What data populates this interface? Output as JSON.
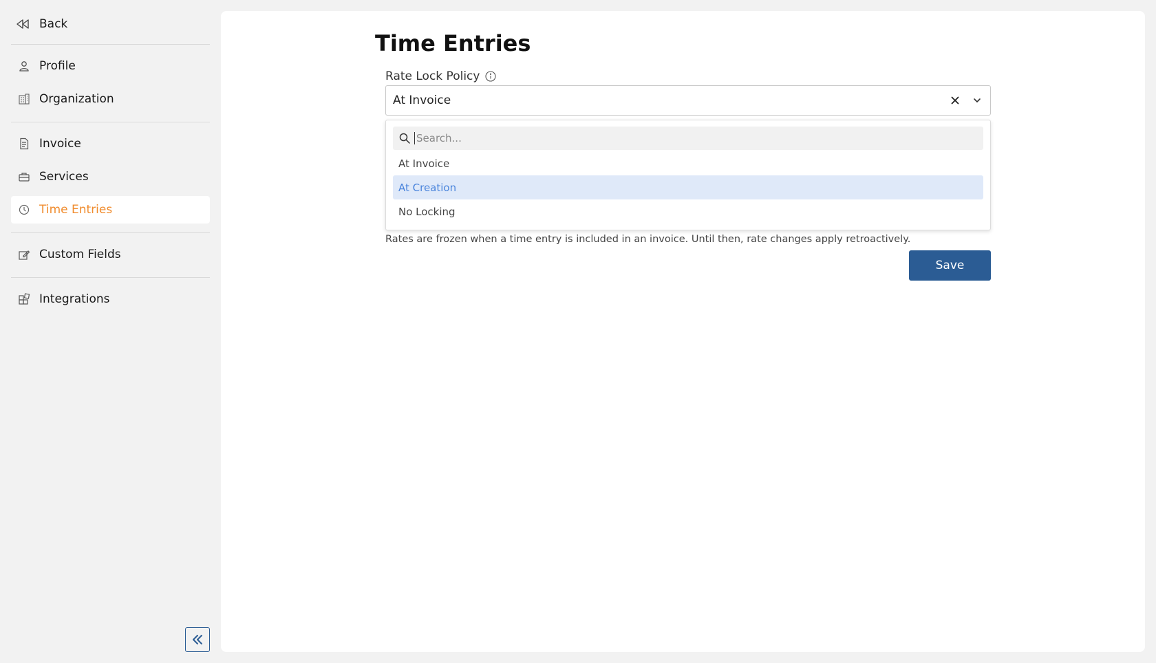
{
  "sidebar": {
    "back_label": "Back",
    "groups": [
      [
        {
          "label": "Profile",
          "icon": "user-icon"
        },
        {
          "label": "Organization",
          "icon": "building-icon"
        }
      ],
      [
        {
          "label": "Invoice",
          "icon": "document-icon"
        },
        {
          "label": "Services",
          "icon": "toolbox-icon"
        },
        {
          "label": "Time Entries",
          "icon": "clock-icon",
          "active": true
        }
      ],
      [
        {
          "label": "Custom Fields",
          "icon": "edit-field-icon"
        }
      ],
      [
        {
          "label": "Integrations",
          "icon": "puzzle-icon"
        }
      ]
    ]
  },
  "main": {
    "title": "Time Entries",
    "field_label": "Rate Lock Policy",
    "selected_value": "At Invoice",
    "search_placeholder": "Search...",
    "options": [
      "At Invoice",
      "At Creation",
      "No Locking"
    ],
    "highlighted_option": "At Creation",
    "help_text": "Rates are frozen when a time entry is included in an invoice. Until then, rate changes apply retroactively.",
    "save_label": "Save"
  },
  "colors": {
    "accent": "#f08c2e",
    "primary": "#2b5c94",
    "highlight_bg": "#dfe9f9",
    "highlight_text": "#4a84dc"
  }
}
